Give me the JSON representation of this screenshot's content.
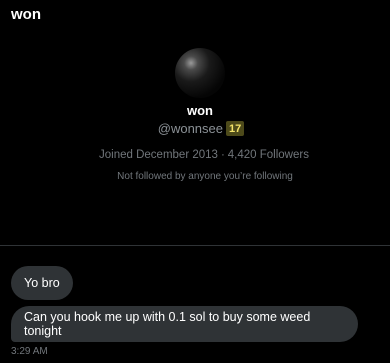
{
  "header": {
    "title": "won"
  },
  "profile": {
    "name": "won",
    "handle": "@wonnsee",
    "badge": "17",
    "joined": "Joined December 2013",
    "separator": "·",
    "followers": "4,420 Followers",
    "followed_note": "Not followed by anyone you’re following"
  },
  "messages": [
    {
      "text": "Yo bro"
    },
    {
      "text": "Can you hook me up with 0.1 sol to buy some weed tonight"
    }
  ],
  "timestamp": "3:29 AM",
  "colors": {
    "background": "#000000",
    "bubble": "#2f3336",
    "muted_text": "#71767b",
    "badge_bg": "#4d4a1a",
    "badge_text": "#f4e36a"
  }
}
